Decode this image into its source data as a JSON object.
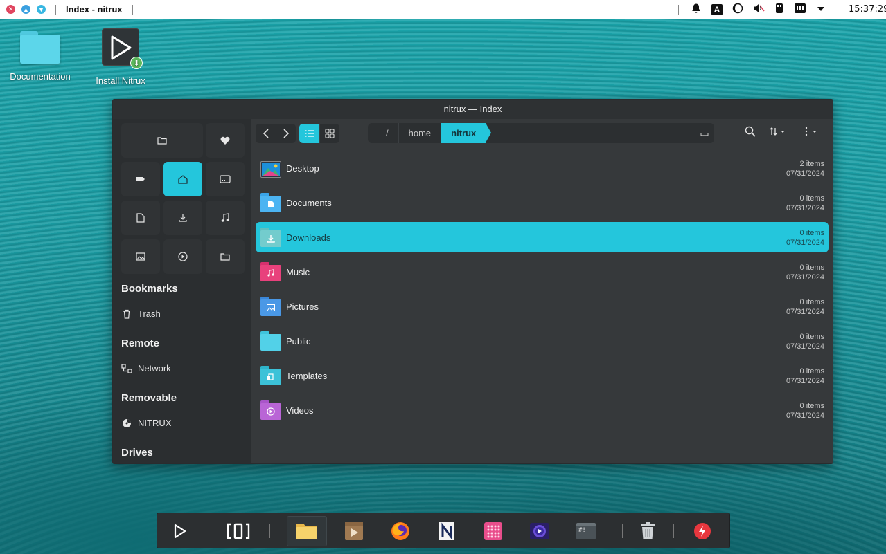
{
  "topbar": {
    "window_title": "Index - nitrux",
    "clock": "15:37:29",
    "tray_a": "A"
  },
  "desktop": {
    "icons": [
      {
        "label": "Documentation"
      },
      {
        "label": "Install Nitrux"
      }
    ]
  },
  "window": {
    "title": "nitrux — Index",
    "breadcrumbs": [
      "/",
      "home",
      "nitrux"
    ],
    "sidebar": {
      "bookmarks_heading": "Bookmarks",
      "trash_label": "Trash",
      "remote_heading": "Remote",
      "network_label": "Network",
      "removable_heading": "Removable",
      "nitrux_label": "NITRUX",
      "drives_heading": "Drives"
    },
    "files": [
      {
        "name": "Desktop",
        "count": "2 items",
        "date": "07/31/2024"
      },
      {
        "name": "Documents",
        "count": "0 items",
        "date": "07/31/2024"
      },
      {
        "name": "Downloads",
        "count": "0 items",
        "date": "07/31/2024"
      },
      {
        "name": "Music",
        "count": "0 items",
        "date": "07/31/2024"
      },
      {
        "name": "Pictures",
        "count": "0 items",
        "date": "07/31/2024"
      },
      {
        "name": "Public",
        "count": "0 items",
        "date": "07/31/2024"
      },
      {
        "name": "Templates",
        "count": "0 items",
        "date": "07/31/2024"
      },
      {
        "name": "Videos",
        "count": "0 items",
        "date": "07/31/2024"
      }
    ]
  },
  "dock": {
    "terminal_label": "#!"
  },
  "colors": {
    "accent": "#24c6dc",
    "window_bg": "#36393b",
    "sidebar_bg": "#2b2e30"
  }
}
